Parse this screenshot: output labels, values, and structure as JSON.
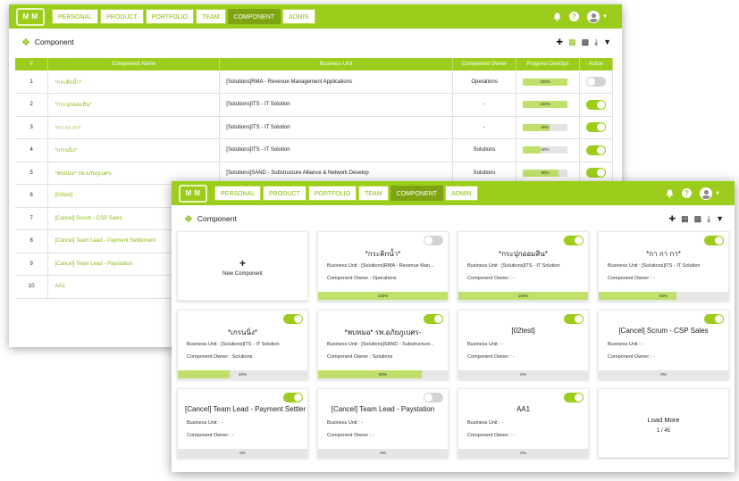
{
  "logo_text": "M M",
  "nav": {
    "tabs": [
      "PERSONAL",
      "PRODUCT",
      "PORTFOLIO",
      "TEAM",
      "COMPONENT",
      "ADMIN"
    ],
    "active": "COMPONENT"
  },
  "header_icons": [
    "bell-icon",
    "help-icon",
    "avatar-icon",
    "caret-down-icon"
  ],
  "help_glyph": "?",
  "page_title": "Component",
  "toolbar_icons": [
    "add-icon",
    "list-view-icon",
    "grid-view-icon",
    "download-icon",
    "filter-icon"
  ],
  "table": {
    "headers": [
      "#",
      "Component Name",
      "Business Unit",
      "Component Owner",
      "Progress DevOps",
      "Action"
    ],
    "rows": [
      {
        "num": "1",
        "name": "*กระติกน้ำ*",
        "bu": "[Solutions]RMA - Revenue Management Applications",
        "owner": "Operations",
        "progress": 100,
        "progress_label": "100%",
        "enabled": false
      },
      {
        "num": "2",
        "name": "*กระปุกออมสิน*",
        "bu": "[Solutions]ITS - IT Solution",
        "owner": "-",
        "progress": 100,
        "progress_label": "100%",
        "enabled": true
      },
      {
        "num": "3",
        "name": "*กา กา กา*",
        "bu": "[Solutions]ITS - IT Solution",
        "owner": "-",
        "progress": 60,
        "progress_label": "60%",
        "enabled": true
      },
      {
        "num": "4",
        "name": "*เกรนนิ่ง*",
        "bu": "[Solutions]ITS - IT Solution",
        "owner": "Solutions",
        "progress": 40,
        "progress_label": "40%",
        "enabled": true
      },
      {
        "num": "5",
        "name": "*พบหมอ* รพ.อภัยภูเบศร-",
        "bu": "[Solutions]SAND - Substructure Alliance & Network Develop",
        "owner": "Solutions",
        "progress": 80,
        "progress_label": "80%",
        "enabled": true
      },
      {
        "num": "6",
        "name": "[02test]",
        "bu": "",
        "owner": "",
        "progress": null,
        "progress_label": "",
        "enabled": null
      },
      {
        "num": "7",
        "name": "[Cancel] Scrum - CSP Sales",
        "bu": "",
        "owner": "",
        "progress": null,
        "progress_label": "",
        "enabled": null
      },
      {
        "num": "8",
        "name": "[Cancel] Team Lead - Payment Settlement",
        "bu": "",
        "owner": "",
        "progress": null,
        "progress_label": "",
        "enabled": null
      },
      {
        "num": "9",
        "name": "[Cancel] Team Lead - Paystation",
        "bu": "",
        "owner": "",
        "progress": null,
        "progress_label": "",
        "enabled": null
      },
      {
        "num": "10",
        "name": "AA1",
        "bu": "",
        "owner": "",
        "progress": null,
        "progress_label": "",
        "enabled": null
      }
    ]
  },
  "cards": {
    "new_label": "New Component",
    "new_glyph": "+",
    "bu_prefix": "Business Unit : ",
    "owner_prefix": "Component Owner : ",
    "items": [
      {
        "name": "*กระติกน้ำ*",
        "bu": "[Solutions]RMA - Revenue Man...",
        "owner": "Operations",
        "progress": 100,
        "progress_label": "100%",
        "enabled": false
      },
      {
        "name": "*กระปุกออมสิน*",
        "bu": "[Solutions]ITS - IT Solution",
        "owner": "-",
        "progress": 100,
        "progress_label": "100%",
        "enabled": true
      },
      {
        "name": "*กา กา กา*",
        "bu": "[Solutions]ITS - IT Solution",
        "owner": "-",
        "progress": 60,
        "progress_label": "60%",
        "enabled": true
      },
      {
        "name": "*เกรนนิ่ง*",
        "bu": "[Solutions]ITS - IT Solution",
        "owner": "Solutions",
        "progress": 40,
        "progress_label": "40%",
        "enabled": true
      },
      {
        "name": "*พบหมอ* รพ.อภัยภูเบศร-",
        "bu": "[Solutions]SAND - Substructure...",
        "owner": "Solutions",
        "progress": 80,
        "progress_label": "80%",
        "enabled": true
      },
      {
        "name": "[02test]",
        "bu": "-",
        "owner": "-",
        "progress": 0,
        "progress_label": "0%",
        "enabled": true
      },
      {
        "name": "[Cancel] Scrum - CSP Sales",
        "bu": "-",
        "owner": "-",
        "progress": 0,
        "progress_label": "0%",
        "enabled": true
      },
      {
        "name": "[Cancel] Team Lead - Payment Settler",
        "bu": "-",
        "owner": "-",
        "progress": 0,
        "progress_label": "0%",
        "enabled": true
      },
      {
        "name": "[Cancel] Team Lead - Paystation",
        "bu": "-",
        "owner": "-",
        "progress": 0,
        "progress_label": "0%",
        "enabled": false
      },
      {
        "name": "AA1",
        "bu": "-",
        "owner": "-",
        "progress": 0,
        "progress_label": "0%",
        "enabled": true
      }
    ],
    "load_more_label": "Load More",
    "pagination": "1 / 45"
  },
  "colors": {
    "brand": "#9ccc1c",
    "active_tab": "#7ea412",
    "progress_fill": "#bfe06a"
  }
}
